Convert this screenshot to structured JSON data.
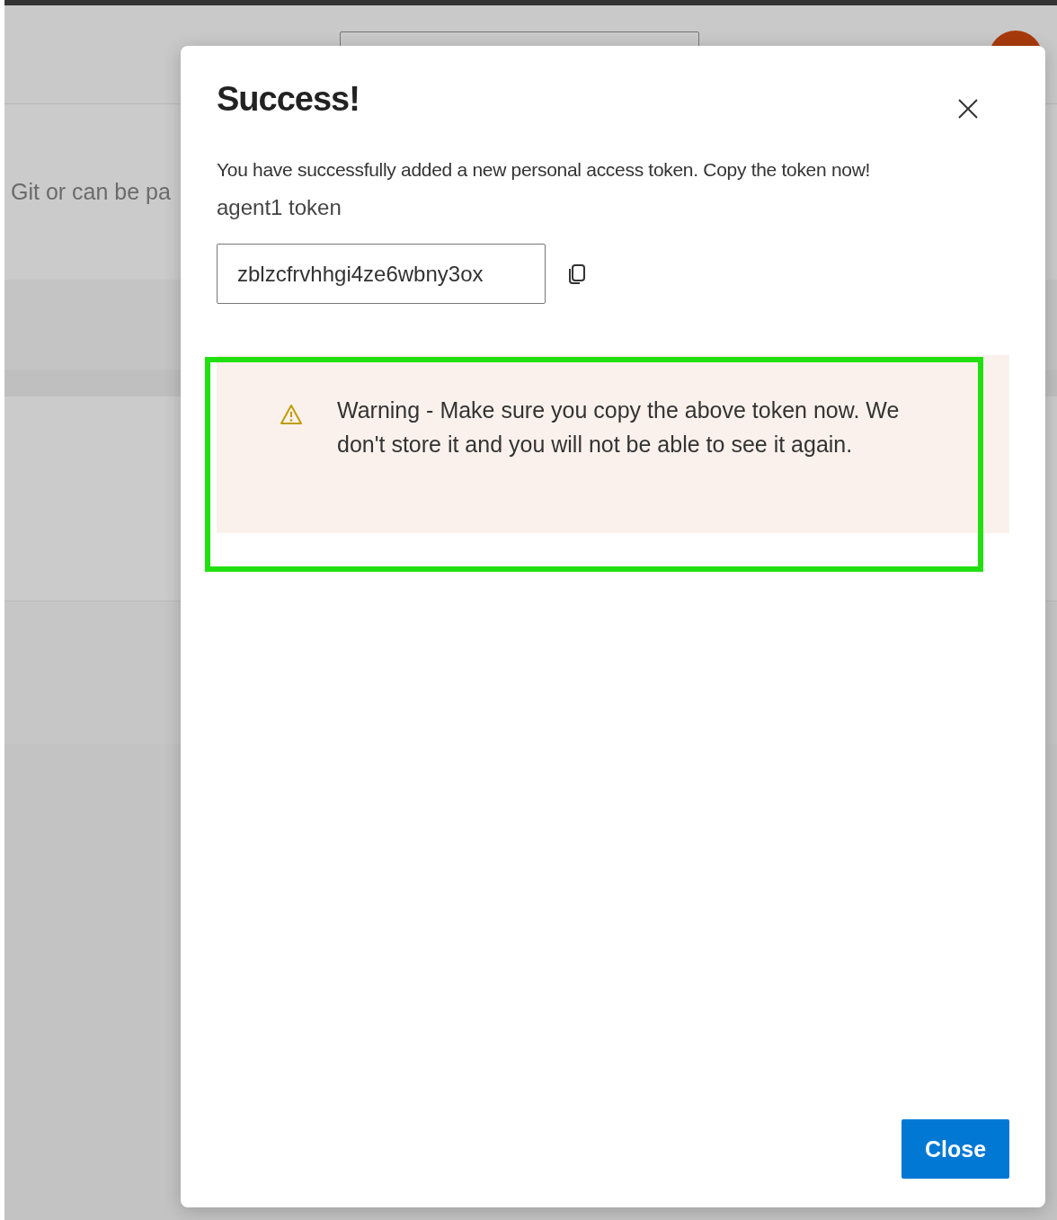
{
  "background": {
    "text": "Git or can be pa"
  },
  "dialog": {
    "title": "Success!",
    "message": "You have successfully added a new personal access token. Copy the token now!",
    "token_name": "agent1 token",
    "token_value": "zblzcfrvhhgi4ze6wbny3ox",
    "warning": "Warning - Make sure you copy the above token now. We don't store it and you will not be able to see it again.",
    "button": "Close"
  }
}
